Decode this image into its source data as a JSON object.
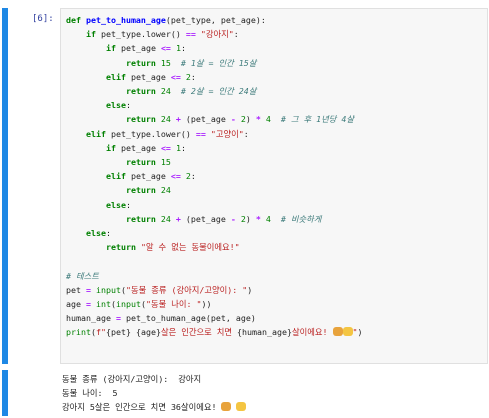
{
  "input_cell": {
    "prompt": "[6]:",
    "lines": [
      [
        [
          "kw",
          "def "
        ],
        [
          "fn",
          "pet_to_human_age"
        ],
        [
          "",
          "(pet_type, pet_age):"
        ]
      ],
      [
        [
          "",
          "    "
        ],
        [
          "kw",
          "if "
        ],
        [
          "",
          "pet_type.lower() "
        ],
        [
          "op",
          "=="
        ],
        [
          "",
          " "
        ],
        [
          "str",
          "\"강아지\""
        ],
        [
          "",
          ":"
        ]
      ],
      [
        [
          "",
          "        "
        ],
        [
          "kw",
          "if "
        ],
        [
          "",
          "pet_age "
        ],
        [
          "op",
          "<="
        ],
        [
          "",
          " "
        ],
        [
          "num",
          "1"
        ],
        [
          "",
          ":"
        ]
      ],
      [
        [
          "",
          "            "
        ],
        [
          "kw",
          "return "
        ],
        [
          "num",
          "15"
        ],
        [
          "",
          "  "
        ],
        [
          "cm",
          "# 1살 = 인간 15살"
        ]
      ],
      [
        [
          "",
          "        "
        ],
        [
          "kw",
          "elif "
        ],
        [
          "",
          "pet_age "
        ],
        [
          "op",
          "<="
        ],
        [
          "",
          " "
        ],
        [
          "num",
          "2"
        ],
        [
          "",
          ":"
        ]
      ],
      [
        [
          "",
          "            "
        ],
        [
          "kw",
          "return "
        ],
        [
          "num",
          "24"
        ],
        [
          "",
          "  "
        ],
        [
          "cm",
          "# 2살 = 인간 24살"
        ]
      ],
      [
        [
          "",
          "        "
        ],
        [
          "kw",
          "else"
        ],
        [
          "",
          ":"
        ]
      ],
      [
        [
          "",
          "            "
        ],
        [
          "kw",
          "return "
        ],
        [
          "num",
          "24"
        ],
        [
          "",
          " "
        ],
        [
          "op",
          "+"
        ],
        [
          "",
          " (pet_age "
        ],
        [
          "op",
          "-"
        ],
        [
          "",
          " "
        ],
        [
          "num",
          "2"
        ],
        [
          "",
          ") "
        ],
        [
          "op",
          "*"
        ],
        [
          "",
          " "
        ],
        [
          "num",
          "4"
        ],
        [
          "",
          "  "
        ],
        [
          "cm",
          "# 그 후 1년당 4살"
        ]
      ],
      [
        [
          "",
          "    "
        ],
        [
          "kw",
          "elif "
        ],
        [
          "",
          "pet_type.lower() "
        ],
        [
          "op",
          "=="
        ],
        [
          "",
          " "
        ],
        [
          "str",
          "\"고양이\""
        ],
        [
          "",
          ":"
        ]
      ],
      [
        [
          "",
          "        "
        ],
        [
          "kw",
          "if "
        ],
        [
          "",
          "pet_age "
        ],
        [
          "op",
          "<="
        ],
        [
          "",
          " "
        ],
        [
          "num",
          "1"
        ],
        [
          "",
          ":"
        ]
      ],
      [
        [
          "",
          "            "
        ],
        [
          "kw",
          "return "
        ],
        [
          "num",
          "15"
        ]
      ],
      [
        [
          "",
          "        "
        ],
        [
          "kw",
          "elif "
        ],
        [
          "",
          "pet_age "
        ],
        [
          "op",
          "<="
        ],
        [
          "",
          " "
        ],
        [
          "num",
          "2"
        ],
        [
          "",
          ":"
        ]
      ],
      [
        [
          "",
          "            "
        ],
        [
          "kw",
          "return "
        ],
        [
          "num",
          "24"
        ]
      ],
      [
        [
          "",
          "        "
        ],
        [
          "kw",
          "else"
        ],
        [
          "",
          ":"
        ]
      ],
      [
        [
          "",
          "            "
        ],
        [
          "kw",
          "return "
        ],
        [
          "num",
          "24"
        ],
        [
          "",
          " "
        ],
        [
          "op",
          "+"
        ],
        [
          "",
          " (pet_age "
        ],
        [
          "op",
          "-"
        ],
        [
          "",
          " "
        ],
        [
          "num",
          "2"
        ],
        [
          "",
          ") "
        ],
        [
          "op",
          "*"
        ],
        [
          "",
          " "
        ],
        [
          "num",
          "4"
        ],
        [
          "",
          "  "
        ],
        [
          "cm",
          "# 비슷하게"
        ]
      ],
      [
        [
          "",
          "    "
        ],
        [
          "kw",
          "else"
        ],
        [
          "",
          ":"
        ]
      ],
      [
        [
          "",
          "        "
        ],
        [
          "kw",
          "return "
        ],
        [
          "str",
          "\"알 수 없는 동물이에요!\""
        ]
      ],
      [
        [
          "",
          ""
        ]
      ],
      [
        [
          "cm",
          "# 테스트"
        ]
      ],
      [
        [
          "",
          "pet "
        ],
        [
          "op",
          "="
        ],
        [
          "",
          " "
        ],
        [
          "bi",
          "input"
        ],
        [
          "",
          "("
        ],
        [
          "str",
          "\"동물 종류 (강아지/고양이): \""
        ],
        [
          "",
          ")"
        ]
      ],
      [
        [
          "",
          "age "
        ],
        [
          "op",
          "="
        ],
        [
          "",
          " "
        ],
        [
          "bi",
          "int"
        ],
        [
          "",
          "("
        ],
        [
          "bi",
          "input"
        ],
        [
          "",
          "("
        ],
        [
          "str",
          "\"동물 나이: \""
        ],
        [
          "",
          "))"
        ]
      ],
      [
        [
          "",
          "human_age "
        ],
        [
          "op",
          "="
        ],
        [
          "",
          " pet_to_human_age(pet, age)"
        ]
      ],
      [
        [
          "bi",
          "print"
        ],
        [
          "",
          "("
        ],
        [
          "str",
          "f\""
        ],
        [
          "",
          "{pet}"
        ],
        [
          "str",
          " "
        ],
        [
          "",
          "{age}"
        ],
        [
          "str",
          "살은 인간으로 치면 "
        ],
        [
          "",
          "{human_age}"
        ],
        [
          "str",
          "살이에요! "
        ],
        [
          "emo-dog",
          ""
        ],
        [
          "emo-cat",
          ""
        ],
        [
          "str",
          "\""
        ],
        [
          "",
          ")"
        ]
      ]
    ]
  },
  "output_cell": {
    "lines": [
      "동물 종류 (강아지/고양이):  강아지",
      "동물 나이:  5",
      "강아지 5살은 인간으로 치면 36살이에요!"
    ],
    "emoji": [
      "dog-face-icon",
      "cat-face-icon"
    ]
  },
  "colors": {
    "cell_bar": "#1e88e5",
    "keyword": "#008000",
    "string": "#ba2121",
    "comment": "#3d7b7b",
    "function_name": "#0000ff",
    "operator": "#aa22ff"
  }
}
